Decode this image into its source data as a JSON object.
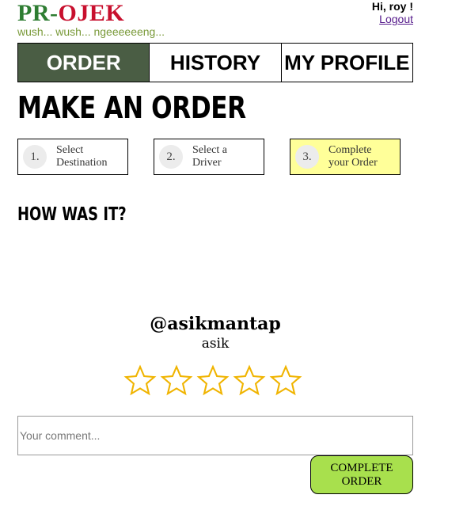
{
  "header": {
    "logo_pr": "PR",
    "logo_dash": "-",
    "logo_ojek": "OJEK",
    "tagline": "wush... wush... ngeeeeeeng...",
    "greeting": "Hi, roy !",
    "logout": "Logout"
  },
  "nav": {
    "tabs": [
      {
        "label": "ORDER",
        "active": true
      },
      {
        "label": "HISTORY",
        "active": false
      },
      {
        "label": "MY PROFILE",
        "active": false
      }
    ]
  },
  "main": {
    "title": "MAKE AN ORDER",
    "steps": [
      {
        "num": "1.",
        "line1": "Select",
        "line2": "Destination"
      },
      {
        "num": "2.",
        "line1": "Select a",
        "line2": "Driver"
      },
      {
        "num": "3.",
        "line1": "Complete",
        "line2": "your Order"
      }
    ],
    "section_title": "HOW WAS IT?",
    "driver_username": "@asikmantap",
    "driver_name": "asik",
    "rating_max": 5,
    "rating_value": 0,
    "comment_placeholder": "Your comment...",
    "complete_line1": "COMPLETE",
    "complete_line2": "ORDER"
  },
  "colors": {
    "logo_green": "#2e7d32",
    "logo_red": "#c8102e",
    "tagline": "#7a9a3a",
    "nav_active": "#4a5d44",
    "step_active": "#ffff99",
    "star_outline": "#f0b400",
    "complete_button": "#a8e04d"
  }
}
